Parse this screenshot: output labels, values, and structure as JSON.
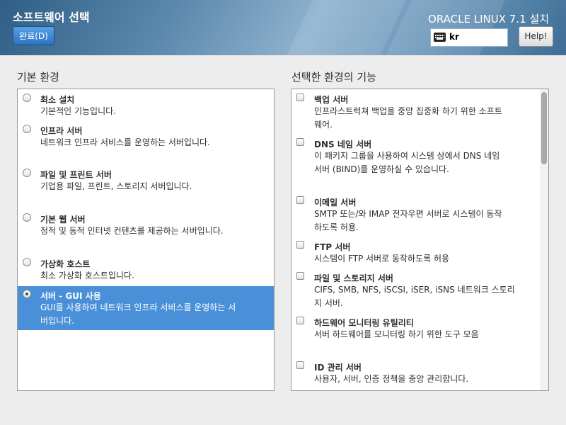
{
  "header": {
    "page_title": "소프트웨어 선택",
    "done_label": "완료(D)",
    "product_title": "ORACLE LINUX 7.1 설치",
    "keyboard_layout": "kr",
    "help_label": "Help!"
  },
  "base_env": {
    "title": "기본 환경",
    "items": [
      {
        "name": "최소 설치",
        "desc": "기본적인 기능입니다."
      },
      {
        "name": "인프라 서버",
        "desc": "네트워크 인프라 서비스를 운영하는 서버입니다."
      },
      {
        "name": "파일 및 프린트 서버",
        "desc": "기업용 파일, 프린트, 스토리지 서버입니다."
      },
      {
        "name": "기본 웹 서버",
        "desc": "정적 및 동적 인터넷 컨텐츠를 제공하는 서버입니다."
      },
      {
        "name": "가상화 호스트",
        "desc": "최소 가상화 호스트입니다."
      },
      {
        "name": "서버 - GUI 사용",
        "desc_line1": "GUI를 사용하여 네트워크 인프라 서비스를 운영하는 서",
        "desc_line2": "버입니다."
      }
    ],
    "selected_index": 5
  },
  "addons": {
    "title": "선택한 환경의 기능",
    "items": [
      {
        "name": "백업 서버",
        "desc_line1": "인프라스트럭쳐 백업을 중앙 집중화 하기 위한 소프트",
        "desc_line2": "웨어."
      },
      {
        "name": "DNS 네임 서버",
        "desc_line1": "이 패키지 그룹을 사용하여 시스템 상에서 DNS 네임",
        "desc_line2": "서버 (BIND)를 운영하실 수 있습니다."
      },
      {
        "name": "이메일 서버",
        "desc_line1": "SMTP 또는/와 IMAP 전자우편 서버로 시스템이 동작",
        "desc_line2": "하도록 허용."
      },
      {
        "name": "FTP 서버",
        "desc_line1": "시스템이 FTP 서버로 동작하도록 허용",
        "desc_line2": ""
      },
      {
        "name": "파일 및 스토리지 서버",
        "desc_line1": "CIFS, SMB, NFS, iSCSI, iSER, iSNS 네트워크 스토리",
        "desc_line2": "지 서버."
      },
      {
        "name": "하드웨어 모니터링 유틸리티",
        "desc_line1": "서버 하드웨어를 모니터링 하기 위한 도구 모음",
        "desc_line2": ""
      },
      {
        "name": "ID 관리 서버",
        "desc_line1": "사용자, 서버, 인증 정책을 중앙 관리합니다.",
        "desc_line2": ""
      }
    ]
  },
  "colors": {
    "accent": "#4a90d9",
    "header_dark": "#2f5e86"
  }
}
